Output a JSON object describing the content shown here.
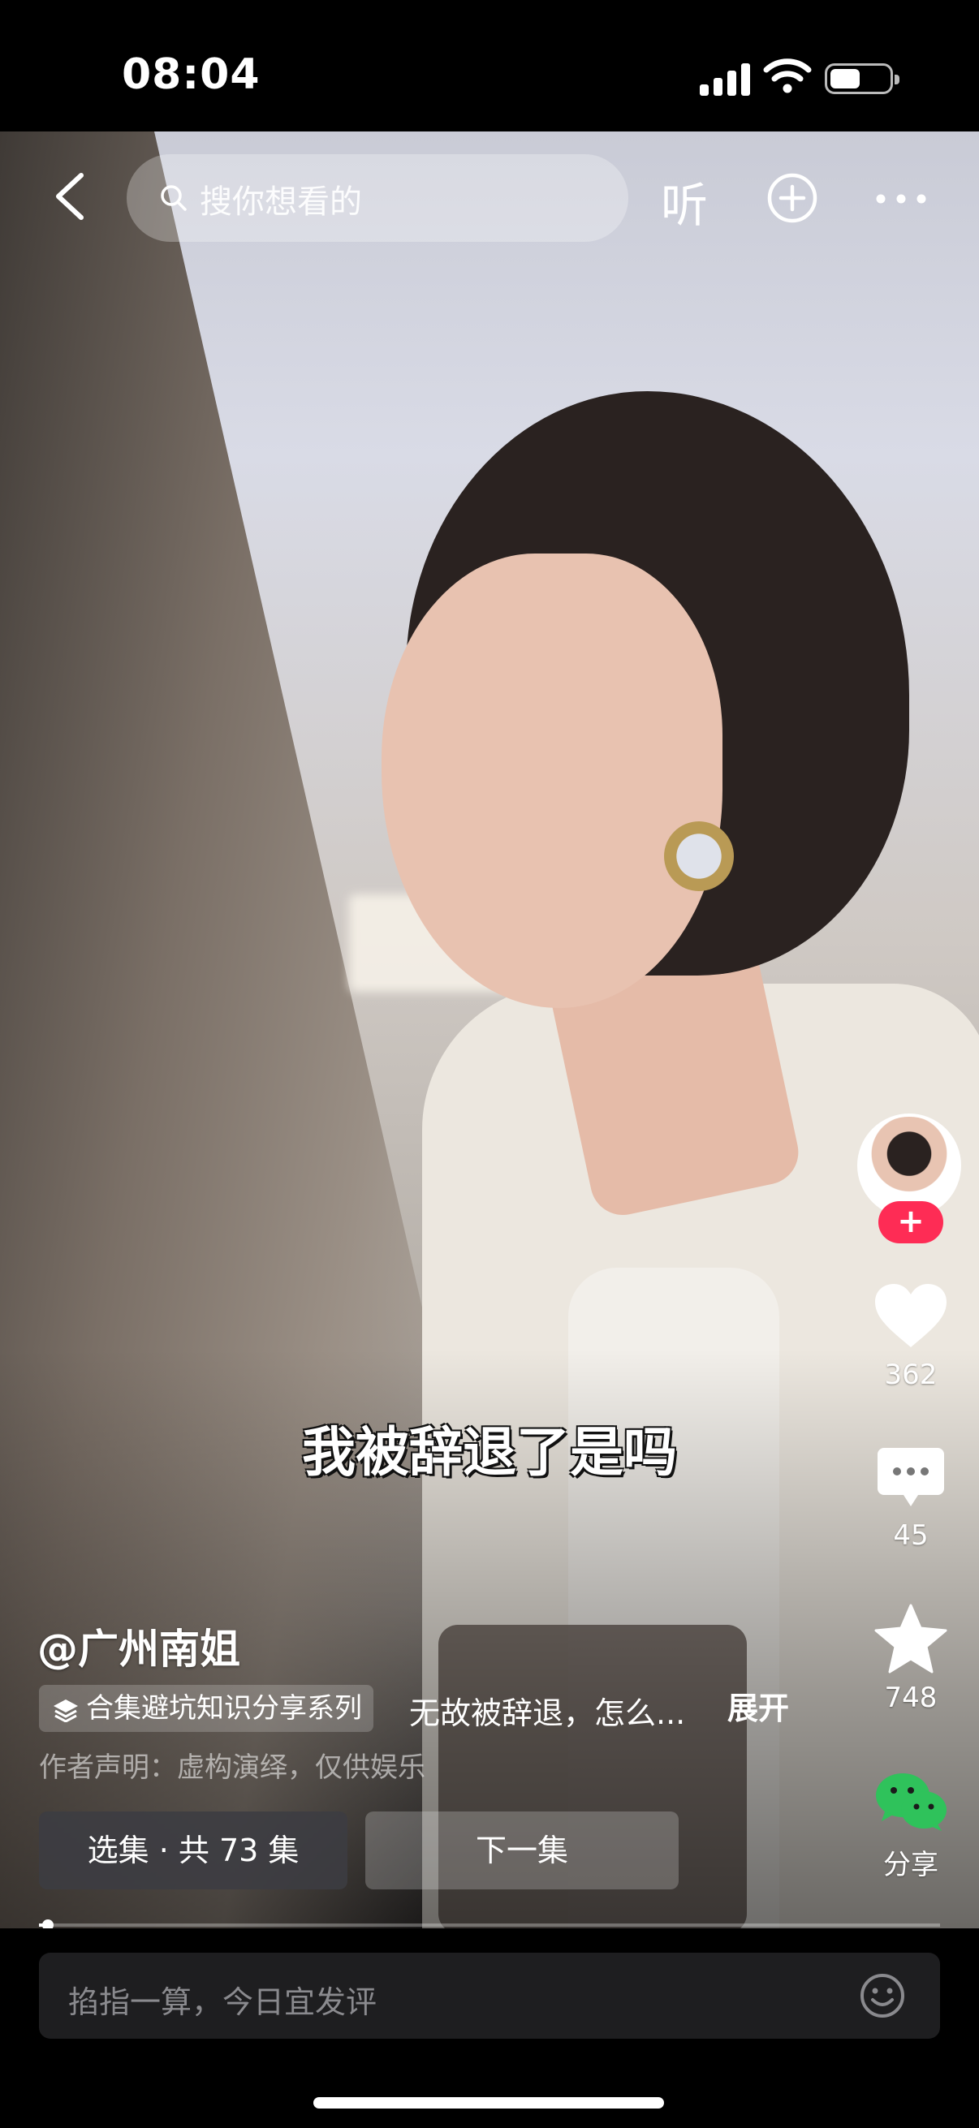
{
  "status_bar": {
    "time": "08:04"
  },
  "top_bar": {
    "search_placeholder": "搜你想看的",
    "listen_label": "听"
  },
  "video": {
    "subtitle": "我被辞退了是吗"
  },
  "rail": {
    "likes": "362",
    "comments": "45",
    "favorites": "748",
    "share_label": "分享",
    "follow_symbol": "+"
  },
  "info": {
    "author": "@广州南姐",
    "collection": "合集避坑知识分享系列",
    "description": "无故被辞退，怎么...",
    "expand_label": "展开",
    "disclaimer": "作者声明：虚构演绎，仅供娱乐"
  },
  "buttons": {
    "episodes": "选集 · 共 73 集",
    "next": "下一集"
  },
  "progress": {
    "fraction": 0.01
  },
  "comment": {
    "placeholder": "掐指一算，今日宜发评"
  },
  "colors": {
    "accent": "#fe2c55",
    "wechat": "#2fc25b"
  }
}
